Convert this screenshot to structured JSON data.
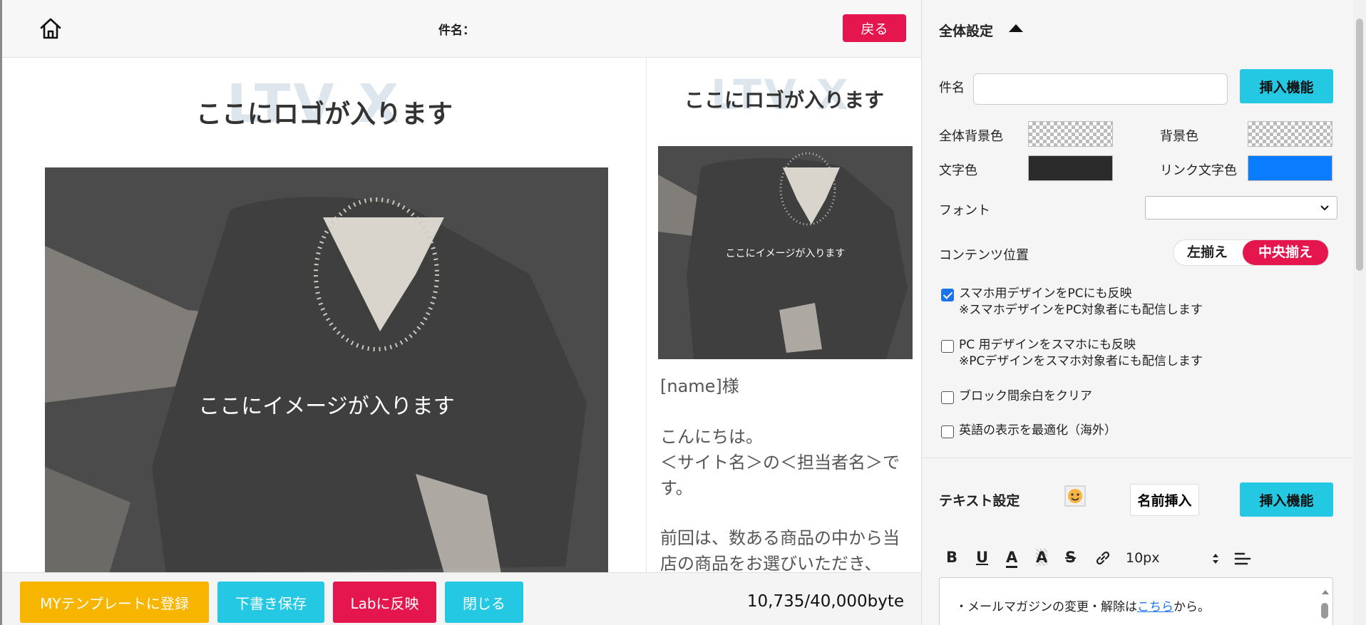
{
  "header": {
    "subject_label": "件名：",
    "back_label": "戻る"
  },
  "preview": {
    "logo_watermark": "LTV X",
    "logo_text": "ここにロゴが入ります",
    "image_caption": "ここにイメージが入ります",
    "sp_greeting": "[name]様",
    "sp_body_1": "こんにちは。",
    "sp_body_2": "＜サイト名＞の＜担当者名＞です。",
    "sp_body_3": "前回は、数ある商品の中から当店の商品をお選びいただき、"
  },
  "footer": {
    "mytemplate_label": "MYテンプレートに登録",
    "draft_label": "下書き保存",
    "lab_label": "Labに反映",
    "close_label": "閉じる",
    "byte_count": "10,735/40,000byte",
    "colors": {
      "yellow": "#f7b500",
      "cyan": "#25c8e3",
      "red": "#e4164d"
    }
  },
  "settings": {
    "title": "全体設定",
    "subject_label": "件名",
    "subject_value": "",
    "insert_label": "挿入機能",
    "bg_all_label": "全体背景色",
    "bg_label": "背景色",
    "text_color_label": "文字色",
    "text_color": "#2b2b2b",
    "link_color_label": "リンク文字色",
    "link_color": "#0a7cff",
    "font_label": "フォント",
    "font_value": "",
    "position_label": "コンテンツ位置",
    "align_left": "左揃え",
    "align_center": "中央揃え",
    "checks": [
      {
        "line1": "スマホ用デザインをPCにも反映",
        "line2": "※スマホデザインをPC対象者にも配信します",
        "checked": true
      },
      {
        "line1": "PC 用デザインをスマホにも反映",
        "line2": "※PCデザインをスマホ対象者にも配信します",
        "checked": false
      },
      {
        "line1": "ブロック間余白をクリア",
        "line2": "",
        "checked": false
      },
      {
        "line1": "英語の表示を最適化（海外）",
        "line2": "",
        "checked": false
      }
    ]
  },
  "text_settings": {
    "title": "テキスト設定",
    "name_insert_label": "名前挿入",
    "insert_label": "挿入機能",
    "font_size": "10px",
    "editor_line_prefix": "・メールマガジンの変更・解除は",
    "editor_link": "こちら",
    "editor_line_suffix": "から。"
  }
}
